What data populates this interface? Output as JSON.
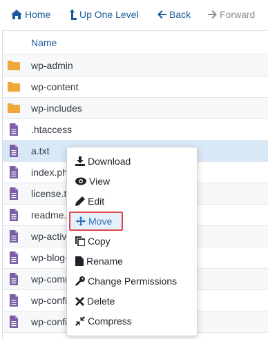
{
  "toolbar": {
    "home": "Home",
    "up": "Up One Level",
    "back": "Back",
    "forward": "Forward"
  },
  "table": {
    "header_name": "Name",
    "rows": [
      {
        "name": "wp-admin",
        "type": "folder"
      },
      {
        "name": "wp-content",
        "type": "folder"
      },
      {
        "name": "wp-includes",
        "type": "folder"
      },
      {
        "name": ".htaccess",
        "type": "file"
      },
      {
        "name": "a.txt",
        "type": "file",
        "selected": true
      },
      {
        "name": "index.php",
        "type": "file"
      },
      {
        "name": "license.txt",
        "type": "file"
      },
      {
        "name": "readme.html",
        "type": "file"
      },
      {
        "name": "wp-activate.php",
        "type": "file"
      },
      {
        "name": "wp-blog-header.php",
        "type": "file"
      },
      {
        "name": "wp-comments-post.php",
        "type": "file"
      },
      {
        "name": "wp-config-sample.php",
        "type": "file"
      },
      {
        "name": "wp-config.php",
        "type": "file"
      }
    ]
  },
  "context_menu": {
    "download": "Download",
    "view": "View",
    "edit": "Edit",
    "move": "Move",
    "copy": "Copy",
    "rename": "Rename",
    "change_permissions": "Change Permissions",
    "delete": "Delete",
    "compress": "Compress"
  },
  "colors": {
    "accent": "#1a5a9a",
    "folder": "#f0a83a",
    "file": "#7b5ea7",
    "selected_row": "#d9e8f6",
    "highlight_border": "#e0464b"
  }
}
